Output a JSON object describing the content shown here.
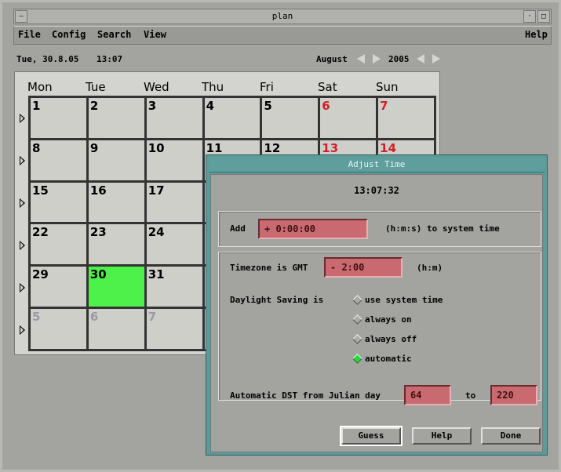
{
  "window": {
    "title": "plan"
  },
  "menubar": {
    "file": "File",
    "config": "Config",
    "search": "Search",
    "view": "View",
    "help": "Help"
  },
  "status": {
    "date": "Tue, 30.8.05",
    "time": "13:07",
    "month": "August",
    "year": "2005"
  },
  "calendar": {
    "weekdays": [
      "Mon",
      "Tue",
      "Wed",
      "Thu",
      "Fri",
      "Sat",
      "Sun"
    ],
    "today": "30",
    "colors": {
      "today": "#4ef04a",
      "weekend": "#d0202a",
      "other_month": "#9a9aa8"
    },
    "rows": [
      [
        "1",
        "2",
        "3",
        "4",
        "5",
        "6",
        "7"
      ],
      [
        "8",
        "9",
        "10",
        "11",
        "12",
        "13",
        "14"
      ],
      [
        "15",
        "16",
        "17",
        "",
        "",
        "",
        ""
      ],
      [
        "22",
        "23",
        "24",
        "",
        "",
        "",
        ""
      ],
      [
        "29",
        "30",
        "31",
        "",
        "",
        "",
        ""
      ],
      [
        "5",
        "6",
        "7",
        "",
        "",
        "",
        ""
      ]
    ]
  },
  "dialog": {
    "title": "Adjust Time",
    "clock": "13:07:32",
    "add_label": "Add",
    "add_value": "+ 0:00:00",
    "add_suffix": "(h:m:s) to system time",
    "tz_label": "Timezone is GMT",
    "tz_value": "- 2:00",
    "tz_suffix": "(h:m)",
    "dst_label": "Daylight Saving is",
    "dst_options": [
      "use system time",
      "always on",
      "always off",
      "automatic"
    ],
    "dst_selected": "automatic",
    "julian_label": "Automatic DST from Julian day",
    "julian_from": "64",
    "julian_to_label": "to",
    "julian_to": "220",
    "buttons": {
      "guess": "Guess",
      "help": "Help",
      "done": "Done"
    }
  }
}
